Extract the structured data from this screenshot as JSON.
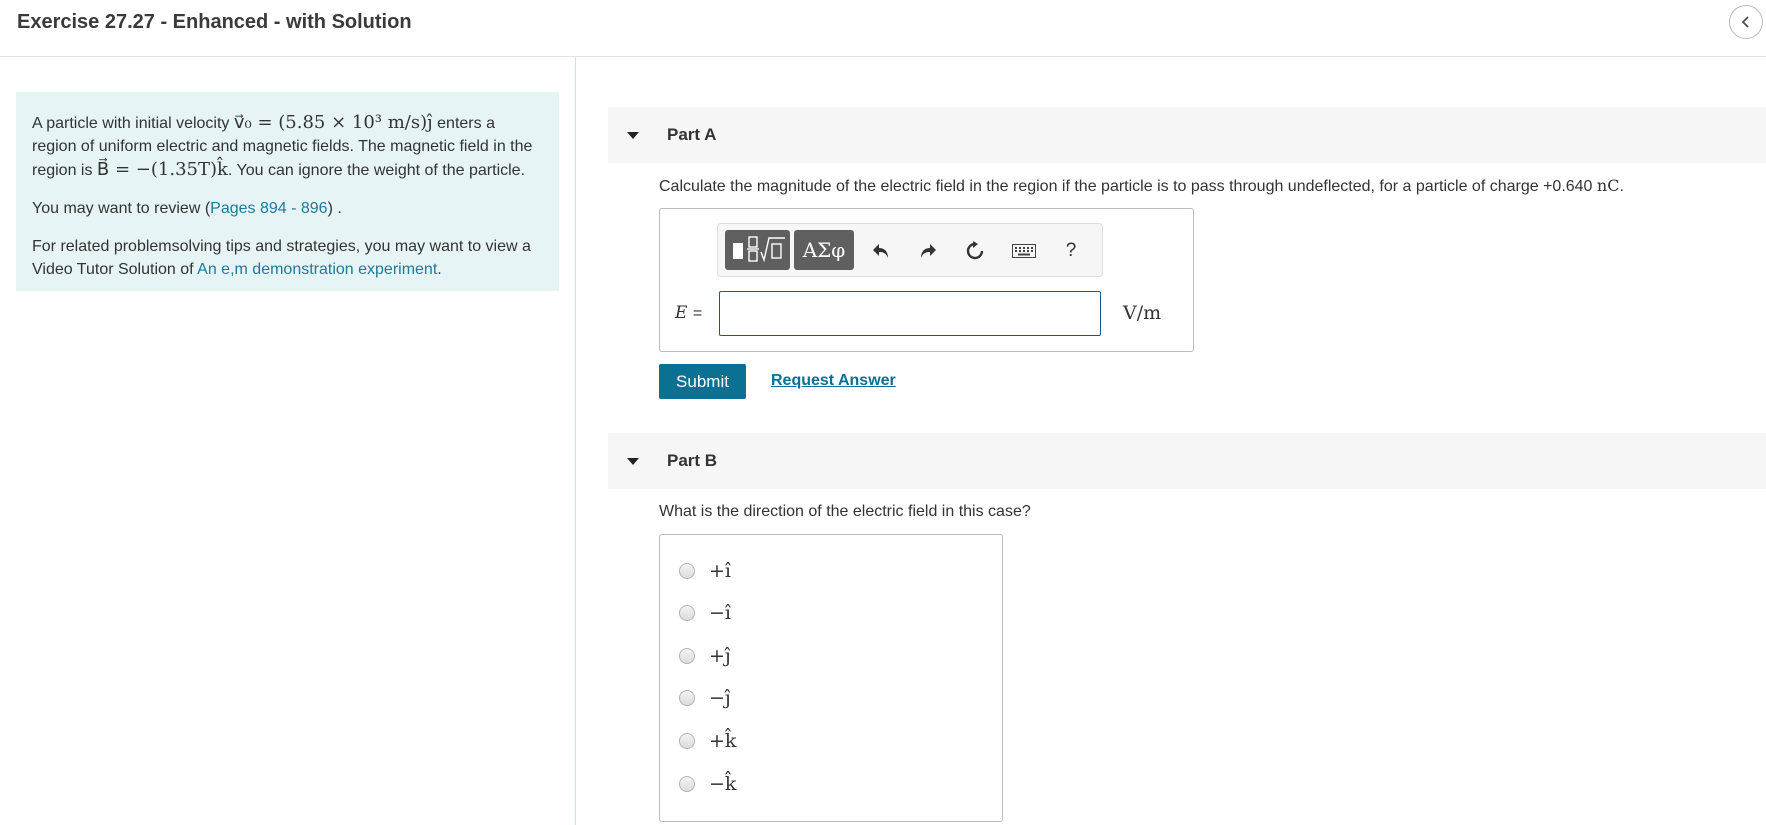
{
  "header": {
    "title": "Exercise 27.27 - Enhanced - with Solution",
    "collapse_icon": "chevron-left-icon"
  },
  "intro": {
    "p1_a": "A particle with initial velocity ",
    "velocity_expr": "v⃗₀ = (5.85 × 10³ m/s)ĵ",
    "p1_b": " enters a region of uniform electric and magnetic fields. The magnetic field in the region is ",
    "field_expr": "B⃗ = −(1.35T)k̂",
    "p1_c": ". You can ignore the weight of the particle.",
    "p2_a": "You may want to review (",
    "p2_link": "Pages 894 - 896",
    "p2_b": ") .",
    "p3_a": "For related problemsolving tips and strategies, you may want to view a Video Tutor Solution of ",
    "p3_link": "An e,m demonstration experiment",
    "p3_b": "."
  },
  "part_a": {
    "title": "Part A",
    "question_a": "Calculate the magnitude of the electric field in the region if the particle is to pass through undeflected, for a particle of charge +0.640 ",
    "question_unit": "nC",
    "question_b": ".",
    "toolbar": {
      "templates_icon": "fraction-sqrt-template-icon",
      "symbols_label": "ΑΣφ",
      "undo_icon": "undo-icon",
      "redo_icon": "redo-icon",
      "reset_icon": "reset-icon",
      "keyboard_icon": "keyboard-icon",
      "help_label": "?"
    },
    "variable": "E",
    "equals": "=",
    "input_value": "",
    "unit": "V/m",
    "submit_label": "Submit",
    "request_label": "Request Answer"
  },
  "part_b": {
    "title": "Part B",
    "question": "What is the direction of the electric field in this case?",
    "choices": [
      "+î",
      "−î",
      "+ĵ",
      "−ĵ",
      "+k̂",
      "−k̂"
    ]
  },
  "colors": {
    "intro_bg": "#e6f4f5",
    "link": "#1c7a9a",
    "submit_bg": "#0b7193",
    "part_header_bg": "#f6f6f6",
    "input_border": "#0f5b8a"
  }
}
